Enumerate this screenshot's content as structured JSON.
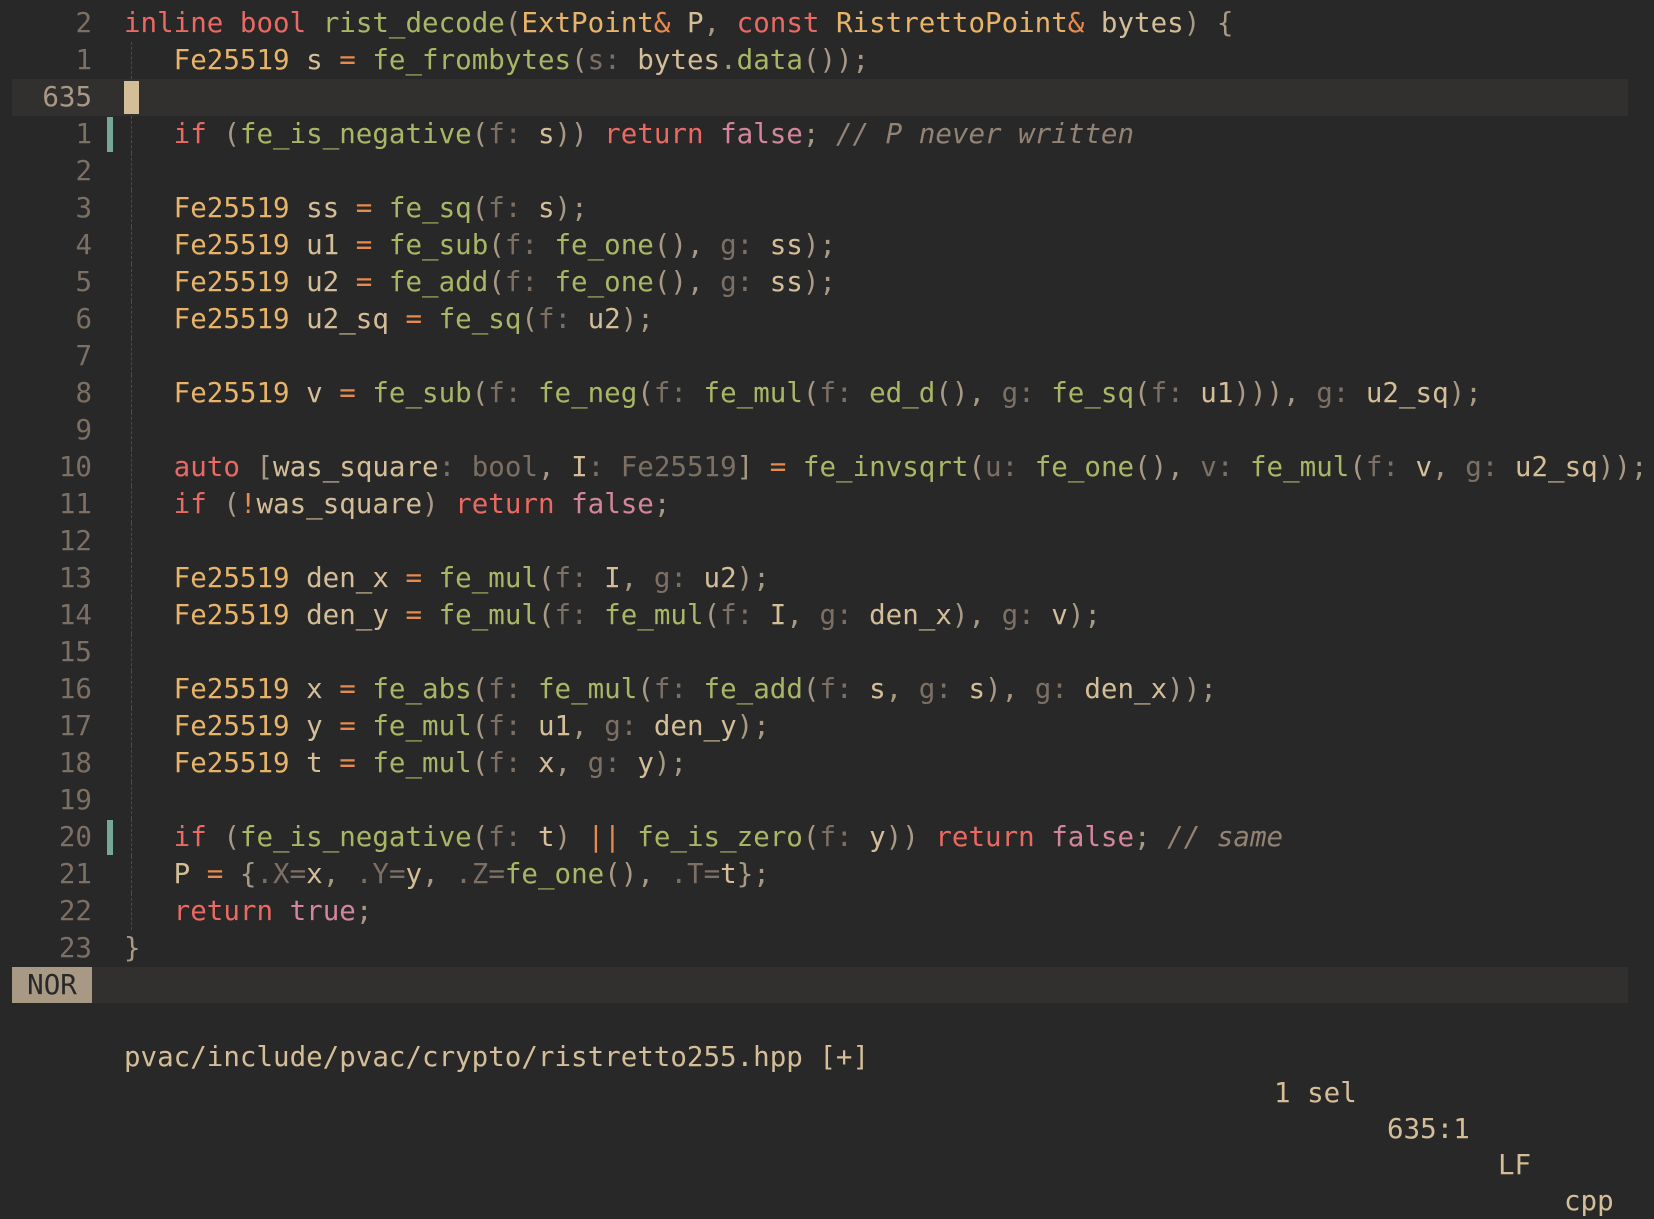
{
  "editor": {
    "mode": "NOR",
    "file_path": "pvac/include/pvac/crypto/ristretto255.hpp",
    "modified": "[+]",
    "selections": "1 sel",
    "cursor_position": "635:1",
    "line_ending": "LF",
    "language": "cpp"
  },
  "colors": {
    "background": "#282828",
    "current_line": "#32302f",
    "keyword": "#ea6962",
    "type": "#e8b46a",
    "function": "#a9b665",
    "operator": "#e78a4e",
    "inlay_hint": "#7c6f64",
    "comment": "#928374",
    "boolean": "#d3869b",
    "git_added": "#76a898"
  },
  "lines": [
    {
      "num": "2",
      "guide": false,
      "segments": [
        [
          "kw",
          "inline "
        ],
        [
          "kw",
          "bool "
        ],
        [
          "fn",
          "rist_decode"
        ],
        [
          "pu",
          "("
        ],
        [
          "ty",
          "ExtPoint"
        ],
        [
          "op",
          "& "
        ],
        [
          "id",
          "P"
        ],
        [
          "pu",
          ", "
        ],
        [
          "kw",
          "const "
        ],
        [
          "ty",
          "RistrettoPoint"
        ],
        [
          "op",
          "& "
        ],
        [
          "id",
          "bytes"
        ],
        [
          "pu",
          ") {"
        ]
      ]
    },
    {
      "num": "1",
      "guide": true,
      "segments": [
        [
          "id",
          "   "
        ],
        [
          "ty",
          "Fe25519 "
        ],
        [
          "id",
          "s "
        ],
        [
          "op",
          "= "
        ],
        [
          "fn",
          "fe_frombytes"
        ],
        [
          "pu",
          "("
        ],
        [
          "hint",
          "s: "
        ],
        [
          "id",
          "bytes"
        ],
        [
          "pu",
          "."
        ],
        [
          "fn",
          "data"
        ],
        [
          "pu",
          "());"
        ]
      ]
    },
    {
      "num": "635",
      "current": true,
      "cursor": true,
      "segments": []
    },
    {
      "num": "1",
      "guide": true,
      "git": true,
      "segments": [
        [
          "id",
          "   "
        ],
        [
          "kw",
          "if "
        ],
        [
          "pu",
          "("
        ],
        [
          "fn",
          "fe_is_negative"
        ],
        [
          "pu",
          "("
        ],
        [
          "hint",
          "f: "
        ],
        [
          "id",
          "s"
        ],
        [
          "pu",
          ")) "
        ],
        [
          "kw",
          "return "
        ],
        [
          "bo",
          "false"
        ],
        [
          "pu",
          "; "
        ],
        [
          "cm",
          "// P never written"
        ]
      ]
    },
    {
      "num": "2",
      "guide": true,
      "segments": []
    },
    {
      "num": "3",
      "guide": true,
      "segments": [
        [
          "id",
          "   "
        ],
        [
          "ty",
          "Fe25519 "
        ],
        [
          "id",
          "ss "
        ],
        [
          "op",
          "= "
        ],
        [
          "fn",
          "fe_sq"
        ],
        [
          "pu",
          "("
        ],
        [
          "hint",
          "f: "
        ],
        [
          "id",
          "s"
        ],
        [
          "pu",
          ");"
        ]
      ]
    },
    {
      "num": "4",
      "guide": true,
      "segments": [
        [
          "id",
          "   "
        ],
        [
          "ty",
          "Fe25519 "
        ],
        [
          "id",
          "u1 "
        ],
        [
          "op",
          "= "
        ],
        [
          "fn",
          "fe_sub"
        ],
        [
          "pu",
          "("
        ],
        [
          "hint",
          "f: "
        ],
        [
          "fn",
          "fe_one"
        ],
        [
          "pu",
          "(), "
        ],
        [
          "hint",
          "g: "
        ],
        [
          "id",
          "ss"
        ],
        [
          "pu",
          ");"
        ]
      ]
    },
    {
      "num": "5",
      "guide": true,
      "segments": [
        [
          "id",
          "   "
        ],
        [
          "ty",
          "Fe25519 "
        ],
        [
          "id",
          "u2 "
        ],
        [
          "op",
          "= "
        ],
        [
          "fn",
          "fe_add"
        ],
        [
          "pu",
          "("
        ],
        [
          "hint",
          "f: "
        ],
        [
          "fn",
          "fe_one"
        ],
        [
          "pu",
          "(), "
        ],
        [
          "hint",
          "g: "
        ],
        [
          "id",
          "ss"
        ],
        [
          "pu",
          ");"
        ]
      ]
    },
    {
      "num": "6",
      "guide": true,
      "segments": [
        [
          "id",
          "   "
        ],
        [
          "ty",
          "Fe25519 "
        ],
        [
          "id",
          "u2_sq "
        ],
        [
          "op",
          "= "
        ],
        [
          "fn",
          "fe_sq"
        ],
        [
          "pu",
          "("
        ],
        [
          "hint",
          "f: "
        ],
        [
          "id",
          "u2"
        ],
        [
          "pu",
          ");"
        ]
      ]
    },
    {
      "num": "7",
      "guide": true,
      "segments": []
    },
    {
      "num": "8",
      "guide": true,
      "segments": [
        [
          "id",
          "   "
        ],
        [
          "ty",
          "Fe25519 "
        ],
        [
          "id",
          "v "
        ],
        [
          "op",
          "= "
        ],
        [
          "fn",
          "fe_sub"
        ],
        [
          "pu",
          "("
        ],
        [
          "hint",
          "f: "
        ],
        [
          "fn",
          "fe_neg"
        ],
        [
          "pu",
          "("
        ],
        [
          "hint",
          "f: "
        ],
        [
          "fn",
          "fe_mul"
        ],
        [
          "pu",
          "("
        ],
        [
          "hint",
          "f: "
        ],
        [
          "fn",
          "ed_d"
        ],
        [
          "pu",
          "(), "
        ],
        [
          "hint",
          "g: "
        ],
        [
          "fn",
          "fe_sq"
        ],
        [
          "pu",
          "("
        ],
        [
          "hint",
          "f: "
        ],
        [
          "id",
          "u1"
        ],
        [
          "pu",
          ")))"
        ],
        [
          "pu",
          ", "
        ],
        [
          "hint",
          "g: "
        ],
        [
          "id",
          "u2_sq"
        ],
        [
          "pu",
          ");"
        ]
      ]
    },
    {
      "num": "9",
      "guide": true,
      "segments": []
    },
    {
      "num": "10",
      "guide": true,
      "segments": [
        [
          "id",
          "   "
        ],
        [
          "kw",
          "auto "
        ],
        [
          "pu",
          "["
        ],
        [
          "id",
          "was_square"
        ],
        [
          "hint",
          ": bool"
        ],
        [
          "pu",
          ", "
        ],
        [
          "id",
          "I"
        ],
        [
          "hint",
          ": Fe25519"
        ],
        [
          "pu",
          "] "
        ],
        [
          "op",
          "= "
        ],
        [
          "fn",
          "fe_invsqrt"
        ],
        [
          "pu",
          "("
        ],
        [
          "hint",
          "u: "
        ],
        [
          "fn",
          "fe_one"
        ],
        [
          "pu",
          "(), "
        ],
        [
          "hint",
          "v: "
        ],
        [
          "fn",
          "fe_mul"
        ],
        [
          "pu",
          "("
        ],
        [
          "hint",
          "f: "
        ],
        [
          "id",
          "v"
        ],
        [
          "pu",
          ", "
        ],
        [
          "hint",
          "g: "
        ],
        [
          "id",
          "u2_sq"
        ],
        [
          "pu",
          "));"
        ]
      ]
    },
    {
      "num": "11",
      "guide": true,
      "segments": [
        [
          "id",
          "   "
        ],
        [
          "kw",
          "if "
        ],
        [
          "pu",
          "("
        ],
        [
          "op",
          "!"
        ],
        [
          "id",
          "was_square"
        ],
        [
          "pu",
          ") "
        ],
        [
          "kw",
          "return "
        ],
        [
          "bo",
          "false"
        ],
        [
          "pu",
          ";"
        ]
      ]
    },
    {
      "num": "12",
      "guide": true,
      "segments": []
    },
    {
      "num": "13",
      "guide": true,
      "segments": [
        [
          "id",
          "   "
        ],
        [
          "ty",
          "Fe25519 "
        ],
        [
          "id",
          "den_x "
        ],
        [
          "op",
          "= "
        ],
        [
          "fn",
          "fe_mul"
        ],
        [
          "pu",
          "("
        ],
        [
          "hint",
          "f: "
        ],
        [
          "id",
          "I"
        ],
        [
          "pu",
          ", "
        ],
        [
          "hint",
          "g: "
        ],
        [
          "id",
          "u2"
        ],
        [
          "pu",
          ");"
        ]
      ]
    },
    {
      "num": "14",
      "guide": true,
      "segments": [
        [
          "id",
          "   "
        ],
        [
          "ty",
          "Fe25519 "
        ],
        [
          "id",
          "den_y "
        ],
        [
          "op",
          "= "
        ],
        [
          "fn",
          "fe_mul"
        ],
        [
          "pu",
          "("
        ],
        [
          "hint",
          "f: "
        ],
        [
          "fn",
          "fe_mul"
        ],
        [
          "pu",
          "("
        ],
        [
          "hint",
          "f: "
        ],
        [
          "id",
          "I"
        ],
        [
          "pu",
          ", "
        ],
        [
          "hint",
          "g: "
        ],
        [
          "id",
          "den_x"
        ],
        [
          "pu",
          "), "
        ],
        [
          "hint",
          "g: "
        ],
        [
          "id",
          "v"
        ],
        [
          "pu",
          ");"
        ]
      ]
    },
    {
      "num": "15",
      "guide": true,
      "segments": []
    },
    {
      "num": "16",
      "guide": true,
      "segments": [
        [
          "id",
          "   "
        ],
        [
          "ty",
          "Fe25519 "
        ],
        [
          "id",
          "x "
        ],
        [
          "op",
          "= "
        ],
        [
          "fn",
          "fe_abs"
        ],
        [
          "pu",
          "("
        ],
        [
          "hint",
          "f: "
        ],
        [
          "fn",
          "fe_mul"
        ],
        [
          "pu",
          "("
        ],
        [
          "hint",
          "f: "
        ],
        [
          "fn",
          "fe_add"
        ],
        [
          "pu",
          "("
        ],
        [
          "hint",
          "f: "
        ],
        [
          "id",
          "s"
        ],
        [
          "pu",
          ", "
        ],
        [
          "hint",
          "g: "
        ],
        [
          "id",
          "s"
        ],
        [
          "pu",
          "), "
        ],
        [
          "hint",
          "g: "
        ],
        [
          "id",
          "den_x"
        ],
        [
          "pu",
          "));"
        ]
      ]
    },
    {
      "num": "17",
      "guide": true,
      "segments": [
        [
          "id",
          "   "
        ],
        [
          "ty",
          "Fe25519 "
        ],
        [
          "id",
          "y "
        ],
        [
          "op",
          "= "
        ],
        [
          "fn",
          "fe_mul"
        ],
        [
          "pu",
          "("
        ],
        [
          "hint",
          "f: "
        ],
        [
          "id",
          "u1"
        ],
        [
          "pu",
          ", "
        ],
        [
          "hint",
          "g: "
        ],
        [
          "id",
          "den_y"
        ],
        [
          "pu",
          ");"
        ]
      ]
    },
    {
      "num": "18",
      "guide": true,
      "segments": [
        [
          "id",
          "   "
        ],
        [
          "ty",
          "Fe25519 "
        ],
        [
          "id",
          "t "
        ],
        [
          "op",
          "= "
        ],
        [
          "fn",
          "fe_mul"
        ],
        [
          "pu",
          "("
        ],
        [
          "hint",
          "f: "
        ],
        [
          "id",
          "x"
        ],
        [
          "pu",
          ", "
        ],
        [
          "hint",
          "g: "
        ],
        [
          "id",
          "y"
        ],
        [
          "pu",
          ");"
        ]
      ]
    },
    {
      "num": "19",
      "guide": true,
      "segments": []
    },
    {
      "num": "20",
      "guide": true,
      "git": true,
      "segments": [
        [
          "id",
          "   "
        ],
        [
          "kw",
          "if "
        ],
        [
          "pu",
          "("
        ],
        [
          "fn",
          "fe_is_negative"
        ],
        [
          "pu",
          "("
        ],
        [
          "hint",
          "f: "
        ],
        [
          "id",
          "t"
        ],
        [
          "pu",
          ") "
        ],
        [
          "op",
          "|| "
        ],
        [
          "fn",
          "fe_is_zero"
        ],
        [
          "pu",
          "("
        ],
        [
          "hint",
          "f: "
        ],
        [
          "id",
          "y"
        ],
        [
          "pu",
          ")) "
        ],
        [
          "kw",
          "return "
        ],
        [
          "bo",
          "false"
        ],
        [
          "pu",
          "; "
        ],
        [
          "cm",
          "// same"
        ]
      ]
    },
    {
      "num": "21",
      "guide": true,
      "segments": [
        [
          "id",
          "   "
        ],
        [
          "id",
          "P "
        ],
        [
          "op",
          "= "
        ],
        [
          "pu",
          "{"
        ],
        [
          "hint",
          ".X="
        ],
        [
          "id",
          "x"
        ],
        [
          "pu",
          ", "
        ],
        [
          "hint",
          ".Y="
        ],
        [
          "id",
          "y"
        ],
        [
          "pu",
          ", "
        ],
        [
          "hint",
          ".Z="
        ],
        [
          "fn",
          "fe_one"
        ],
        [
          "pu",
          "(), "
        ],
        [
          "hint",
          ".T="
        ],
        [
          "id",
          "t"
        ],
        [
          "pu",
          "};"
        ]
      ]
    },
    {
      "num": "22",
      "guide": true,
      "segments": [
        [
          "id",
          "   "
        ],
        [
          "kw",
          "return "
        ],
        [
          "bo",
          "true"
        ],
        [
          "pu",
          ";"
        ]
      ]
    },
    {
      "num": "23",
      "guide": false,
      "segments": [
        [
          "pu",
          "}"
        ]
      ]
    }
  ]
}
